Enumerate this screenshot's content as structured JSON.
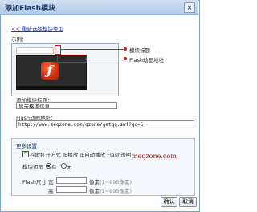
{
  "dialog": {
    "title": "添加Flash模块",
    "close_glyph": "×"
  },
  "back_link": "<< 重新选择模块类型",
  "example": {
    "label": "示例：",
    "title_placeholder": "··········",
    "callout_title": "模块标题",
    "callout_flash": "Flash动画地址"
  },
  "form": {
    "title_label": "添加模块标题：",
    "title_value": "显示格调信息",
    "url_label": "Flash动画地址：",
    "url_value": "http://www.meqzone.com/qzone/getqq.swf?qq=5"
  },
  "settings": {
    "heading": "更多设置",
    "autoplay_text": "谷歌打开方式 IE播放 IE自动播放 Flash透明",
    "autoplay_checked": true,
    "watermark": "meqzone.com",
    "border_label": "模块边框",
    "border_yes": "有",
    "border_no": "无",
    "border_selected": "有",
    "size_label": "Flash尺寸",
    "width_label": "宽",
    "height_label": "高",
    "width_value": "",
    "height_value": "",
    "unit": "像素",
    "width_hint": "(1~895像素)",
    "height_hint": "(1~895像素)"
  },
  "buttons": {
    "ok": "确认",
    "cancel": "取消"
  },
  "colors": {
    "accent_red": "#d8161a",
    "title_blue": "#1d3b66",
    "link_blue": "#1a3fb0"
  }
}
